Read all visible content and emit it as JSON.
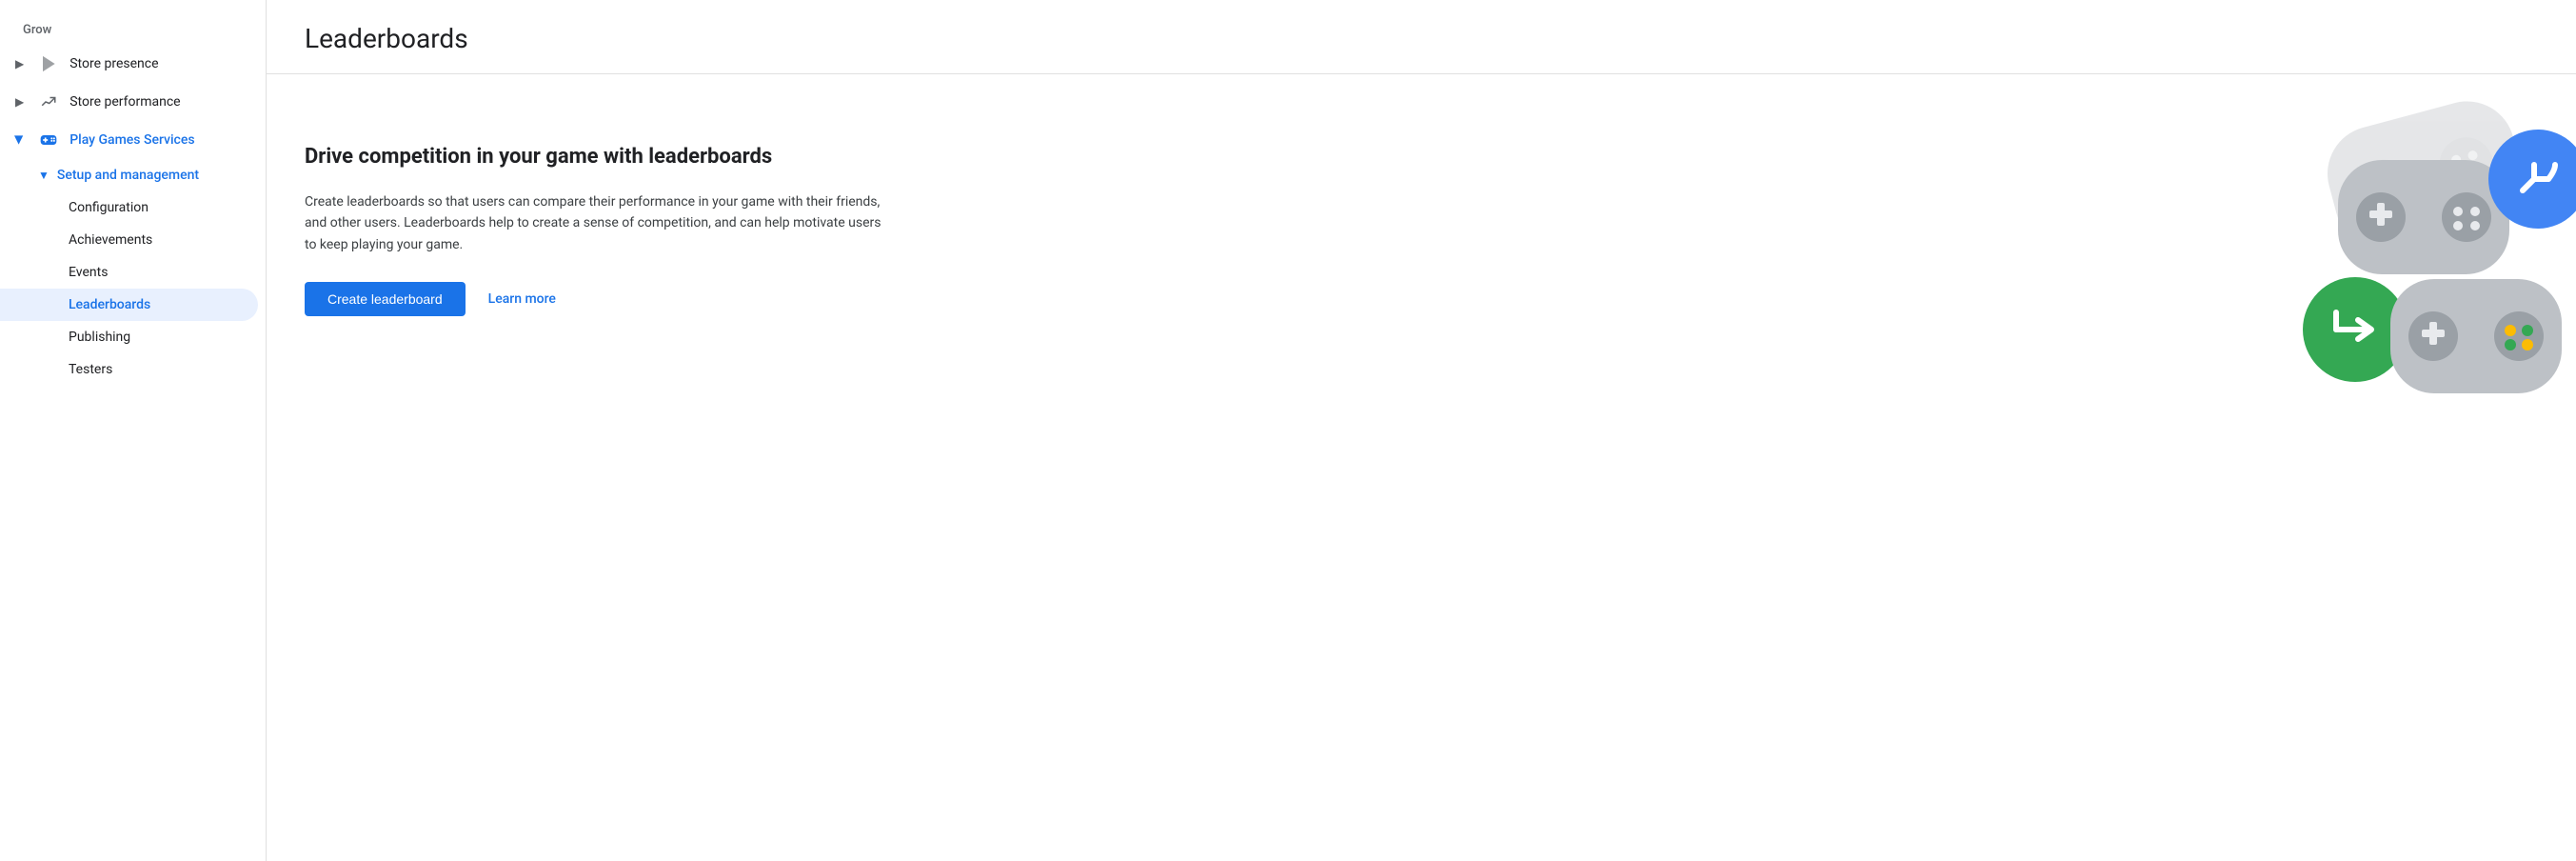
{
  "sidebar": {
    "section_label": "Grow",
    "items": [
      {
        "id": "store-presence",
        "label": "Store presence",
        "icon": "play-icon",
        "expanded": false,
        "active": false,
        "has_chevron": true
      },
      {
        "id": "store-performance",
        "label": "Store performance",
        "icon": "trending-icon",
        "expanded": false,
        "active": false,
        "has_chevron": true
      },
      {
        "id": "play-games-services",
        "label": "Play Games Services",
        "icon": "gamepad-icon",
        "expanded": true,
        "active": false,
        "has_chevron": true,
        "blue": true
      }
    ],
    "sub_items": [
      {
        "id": "setup-and-management",
        "label": "Setup and management",
        "expanded": true,
        "blue": true
      }
    ],
    "sub_sub_items": [
      {
        "id": "configuration",
        "label": "Configuration",
        "active": false
      },
      {
        "id": "achievements",
        "label": "Achievements",
        "active": false
      },
      {
        "id": "events",
        "label": "Events",
        "active": false
      },
      {
        "id": "leaderboards",
        "label": "Leaderboards",
        "active": true
      },
      {
        "id": "publishing",
        "label": "Publishing",
        "active": false
      },
      {
        "id": "testers",
        "label": "Testers",
        "active": false
      }
    ]
  },
  "page": {
    "title": "Leaderboards",
    "content_heading": "Drive competition in your game with leaderboards",
    "content_description": "Create leaderboards so that users can compare their performance in your game with their friends, and other users. Leaderboards help to create a sense of competition, and can help motivate users to keep playing your game.",
    "create_button_label": "Create leaderboard",
    "learn_more_label": "Learn more"
  }
}
